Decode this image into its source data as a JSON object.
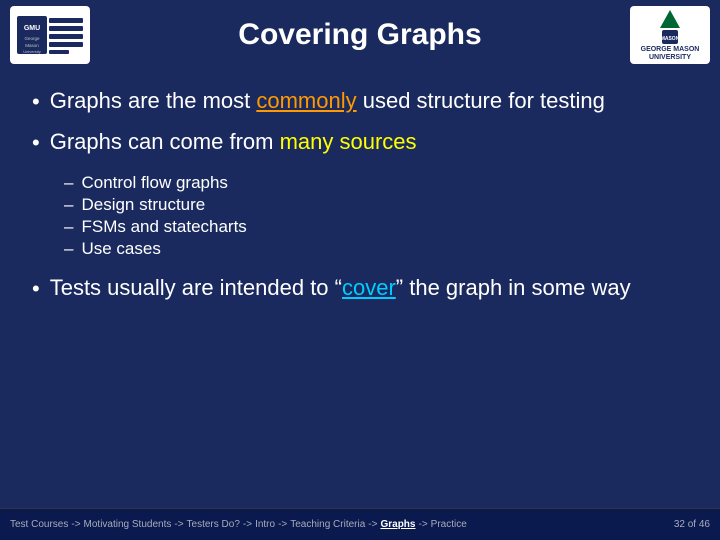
{
  "header": {
    "title": "Covering Graphs"
  },
  "gmu": {
    "logo_line1": "GMU",
    "logo_line2": "George Mason\nUniversity"
  },
  "mason": {
    "logo_text": "GEORGE\nMASON\nUNIVERSITY"
  },
  "bullets": [
    {
      "text_plain": "Graphs are the most ",
      "text_highlight": "commonly",
      "text_after": " used structure for testing"
    },
    {
      "text_plain": "Graphs can come from ",
      "text_highlight": "many sources"
    }
  ],
  "sub_items": [
    {
      "label": "Control flow graphs"
    },
    {
      "label": "Design structure"
    },
    {
      "label": "FSMs and statecharts"
    },
    {
      "label": "Use cases"
    }
  ],
  "bullet3": {
    "text1": "Tests usually are intended to “",
    "highlight": "cover",
    "text2": "” the graph in some way"
  },
  "footer": {
    "items": [
      "Test Courses",
      "Motivating Students",
      "Testers Do?",
      "Intro",
      "Teaching Criteria",
      "Graphs",
      "Practice"
    ],
    "active_index": 5,
    "page": "32",
    "total": "46"
  }
}
